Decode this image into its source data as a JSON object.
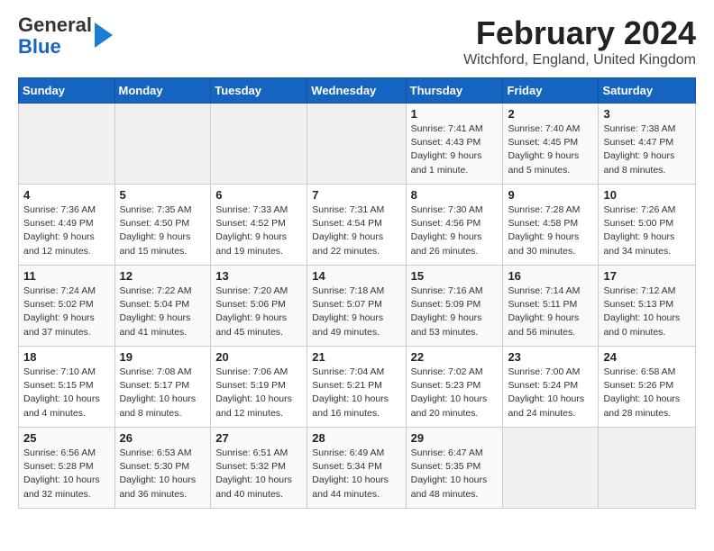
{
  "header": {
    "logo_line1": "General",
    "logo_line2": "Blue",
    "title": "February 2024",
    "subtitle": "Witchford, England, United Kingdom"
  },
  "weekdays": [
    "Sunday",
    "Monday",
    "Tuesday",
    "Wednesday",
    "Thursday",
    "Friday",
    "Saturday"
  ],
  "weeks": [
    [
      {
        "day": "",
        "info": ""
      },
      {
        "day": "",
        "info": ""
      },
      {
        "day": "",
        "info": ""
      },
      {
        "day": "",
        "info": ""
      },
      {
        "day": "1",
        "info": "Sunrise: 7:41 AM\nSunset: 4:43 PM\nDaylight: 9 hours and 1 minute."
      },
      {
        "day": "2",
        "info": "Sunrise: 7:40 AM\nSunset: 4:45 PM\nDaylight: 9 hours and 5 minutes."
      },
      {
        "day": "3",
        "info": "Sunrise: 7:38 AM\nSunset: 4:47 PM\nDaylight: 9 hours and 8 minutes."
      }
    ],
    [
      {
        "day": "4",
        "info": "Sunrise: 7:36 AM\nSunset: 4:49 PM\nDaylight: 9 hours and 12 minutes."
      },
      {
        "day": "5",
        "info": "Sunrise: 7:35 AM\nSunset: 4:50 PM\nDaylight: 9 hours and 15 minutes."
      },
      {
        "day": "6",
        "info": "Sunrise: 7:33 AM\nSunset: 4:52 PM\nDaylight: 9 hours and 19 minutes."
      },
      {
        "day": "7",
        "info": "Sunrise: 7:31 AM\nSunset: 4:54 PM\nDaylight: 9 hours and 22 minutes."
      },
      {
        "day": "8",
        "info": "Sunrise: 7:30 AM\nSunset: 4:56 PM\nDaylight: 9 hours and 26 minutes."
      },
      {
        "day": "9",
        "info": "Sunrise: 7:28 AM\nSunset: 4:58 PM\nDaylight: 9 hours and 30 minutes."
      },
      {
        "day": "10",
        "info": "Sunrise: 7:26 AM\nSunset: 5:00 PM\nDaylight: 9 hours and 34 minutes."
      }
    ],
    [
      {
        "day": "11",
        "info": "Sunrise: 7:24 AM\nSunset: 5:02 PM\nDaylight: 9 hours and 37 minutes."
      },
      {
        "day": "12",
        "info": "Sunrise: 7:22 AM\nSunset: 5:04 PM\nDaylight: 9 hours and 41 minutes."
      },
      {
        "day": "13",
        "info": "Sunrise: 7:20 AM\nSunset: 5:06 PM\nDaylight: 9 hours and 45 minutes."
      },
      {
        "day": "14",
        "info": "Sunrise: 7:18 AM\nSunset: 5:07 PM\nDaylight: 9 hours and 49 minutes."
      },
      {
        "day": "15",
        "info": "Sunrise: 7:16 AM\nSunset: 5:09 PM\nDaylight: 9 hours and 53 minutes."
      },
      {
        "day": "16",
        "info": "Sunrise: 7:14 AM\nSunset: 5:11 PM\nDaylight: 9 hours and 56 minutes."
      },
      {
        "day": "17",
        "info": "Sunrise: 7:12 AM\nSunset: 5:13 PM\nDaylight: 10 hours and 0 minutes."
      }
    ],
    [
      {
        "day": "18",
        "info": "Sunrise: 7:10 AM\nSunset: 5:15 PM\nDaylight: 10 hours and 4 minutes."
      },
      {
        "day": "19",
        "info": "Sunrise: 7:08 AM\nSunset: 5:17 PM\nDaylight: 10 hours and 8 minutes."
      },
      {
        "day": "20",
        "info": "Sunrise: 7:06 AM\nSunset: 5:19 PM\nDaylight: 10 hours and 12 minutes."
      },
      {
        "day": "21",
        "info": "Sunrise: 7:04 AM\nSunset: 5:21 PM\nDaylight: 10 hours and 16 minutes."
      },
      {
        "day": "22",
        "info": "Sunrise: 7:02 AM\nSunset: 5:23 PM\nDaylight: 10 hours and 20 minutes."
      },
      {
        "day": "23",
        "info": "Sunrise: 7:00 AM\nSunset: 5:24 PM\nDaylight: 10 hours and 24 minutes."
      },
      {
        "day": "24",
        "info": "Sunrise: 6:58 AM\nSunset: 5:26 PM\nDaylight: 10 hours and 28 minutes."
      }
    ],
    [
      {
        "day": "25",
        "info": "Sunrise: 6:56 AM\nSunset: 5:28 PM\nDaylight: 10 hours and 32 minutes."
      },
      {
        "day": "26",
        "info": "Sunrise: 6:53 AM\nSunset: 5:30 PM\nDaylight: 10 hours and 36 minutes."
      },
      {
        "day": "27",
        "info": "Sunrise: 6:51 AM\nSunset: 5:32 PM\nDaylight: 10 hours and 40 minutes."
      },
      {
        "day": "28",
        "info": "Sunrise: 6:49 AM\nSunset: 5:34 PM\nDaylight: 10 hours and 44 minutes."
      },
      {
        "day": "29",
        "info": "Sunrise: 6:47 AM\nSunset: 5:35 PM\nDaylight: 10 hours and 48 minutes."
      },
      {
        "day": "",
        "info": ""
      },
      {
        "day": "",
        "info": ""
      }
    ]
  ]
}
